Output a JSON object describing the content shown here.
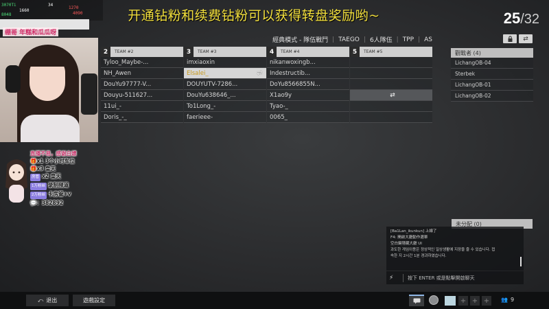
{
  "stream_overlay": {
    "banner": "开通钻粉和续费钻粉可以获得转盘奖励哟~",
    "caption": "绷哥 年糕和瓜瓜呀",
    "stats": [
      "3070Ti",
      "1660",
      "8048",
      "34",
      "1270",
      "4090"
    ],
    "notices": [
      "直播不易，感谢白嫖",
      "x1 3个小时车位",
      "x3 皇天",
      "x2 皇天",
      "录制频道",
      "卡房管+v",
      "：382892"
    ],
    "tags": [
      "房管",
      "1万粉丝",
      "2万粉丝"
    ]
  },
  "counter": {
    "current": "25",
    "separator": "/",
    "total": "32"
  },
  "mode_bar": {
    "mode": "經典模式 - 隊伍戰鬥",
    "server": "TAEGO",
    "team_size": "6人隊伍",
    "perspective": "TPP",
    "region": "AS"
  },
  "teams": [
    {
      "num": "2",
      "name": "TEAM #2",
      "players": [
        "Tyloo_Maybe-...",
        "NH_Awen",
        "DouYu97777-V...",
        "Douyu-511627...",
        "11ui_-",
        "Doris_-_"
      ]
    },
    {
      "num": "3",
      "name": "TEAM #3",
      "players": [
        "imxiaoxin",
        "Elsalei_",
        "DOUYUTV-7286...",
        "DouYu638646_...",
        "To1Long_-",
        "faerieee-"
      ]
    },
    {
      "num": "4",
      "name": "TEAM #4",
      "players": [
        "nikanwoxingb...",
        "Indestructib...",
        "DoYu8566855N...",
        "X1ao9y",
        "Tyao-_",
        "0065_"
      ]
    },
    {
      "num": "5",
      "name": "TEAM #5",
      "players": [
        "",
        "",
        "",
        "",
        "",
        ""
      ]
    }
  ],
  "highlight_player": "Elsalei_",
  "swap_glyph": "⇄",
  "spectators": {
    "header": "觀戰者 (4)",
    "list": [
      "LichangOB-04",
      "Sterbek",
      "LichangOB-01",
      "LichangOB-02"
    ]
  },
  "unassigned": {
    "header": "未分配 (0)"
  },
  "chat": {
    "lines": [
      {
        "name": "[Ba1Lan_ikunkun]",
        "text": "上線了"
      },
      {
        "name": "",
        "text": "F4: 開啟大廳動作選單"
      },
      {
        "name": "",
        "text": "空白鍵隱藏大廳 UI"
      },
      {
        "name": "",
        "text": "과도한 게임이용은 정상적인 일상생활에 지장을 줄 수 있습니다. 접"
      },
      {
        "name": "",
        "text": "속한 지 2시간 1분 경과하였습니다."
      }
    ],
    "input_placeholder": "按下 ENTER 或是點擊開啟聊天"
  },
  "bottom_bar": {
    "exit_label": "退出",
    "settings_label": "遊戲設定",
    "party_count": "9"
  },
  "colors": {
    "banner": "#f2df3c",
    "highlight_text": "#c89a1c",
    "header_bg": "#cfcfcf"
  }
}
